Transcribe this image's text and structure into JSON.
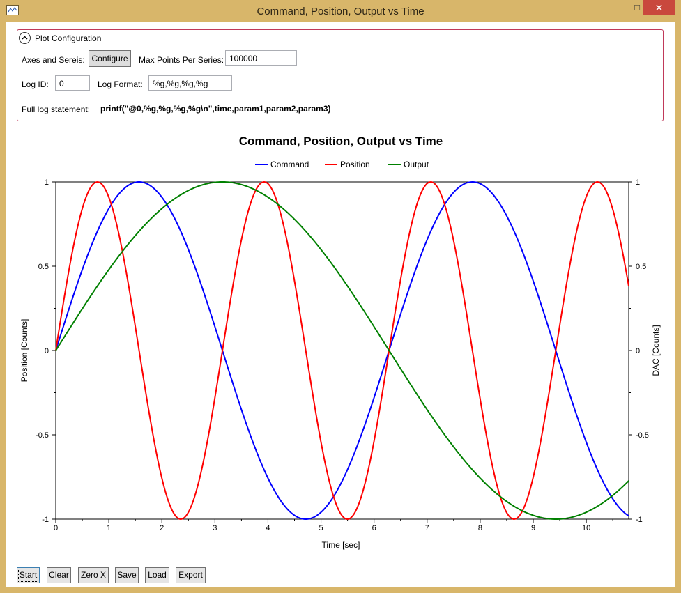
{
  "window": {
    "title": "Command, Position, Output vs Time",
    "minimize": "‒",
    "maximize": "□",
    "close": "✕"
  },
  "config": {
    "header": "Plot Configuration",
    "axes_label": "Axes and Sereis:",
    "configure_button": "Configure",
    "max_points_label": "Max Points Per Series:",
    "max_points_value": "100000",
    "log_id_label": "Log ID:",
    "log_id_value": "0",
    "log_format_label": "Log Format:",
    "log_format_value": "%g,%g,%g,%g",
    "full_log_label": "Full log statement:",
    "full_log_value": "printf(\"@0,%g,%g,%g,%g\\n\",time,param1,param2,param3)"
  },
  "buttons": {
    "start": "Start",
    "clear": "Clear",
    "zero_x": "Zero X",
    "save": "Save",
    "load": "Load",
    "export": "Export"
  },
  "chart_data": {
    "type": "line",
    "title": "Command, Position, Output vs Time",
    "xlabel": "Time [sec]",
    "ylabel": "Position [Counts]",
    "y2label": "DAC [Counts]",
    "xlim": [
      0,
      10.8
    ],
    "ylim": [
      -1,
      1
    ],
    "y2lim": [
      -1,
      1
    ],
    "x_ticks": [
      "0",
      "1",
      "2",
      "3",
      "4",
      "5",
      "6",
      "7",
      "8",
      "9",
      "10"
    ],
    "y_ticks": [
      "1",
      "0.5",
      "0",
      "-0.5",
      "-1"
    ],
    "legend_position": "top-center",
    "grid": false,
    "series": [
      {
        "name": "Command",
        "color": "#0000ff",
        "function": "sin(t)",
        "x": [
          0,
          0.4,
          0.8,
          1.2,
          1.57,
          2.0,
          2.4,
          2.8,
          3.14,
          3.6,
          4.0,
          4.4,
          4.71,
          5.2,
          5.6,
          6.0,
          6.28,
          6.8,
          7.2,
          7.6,
          7.85,
          8.2,
          8.6,
          9.0,
          9.42,
          9.8,
          10.2,
          10.6,
          10.8
        ],
        "values": [
          0,
          0.39,
          0.72,
          0.93,
          1.0,
          0.91,
          0.68,
          0.33,
          0,
          -0.44,
          -0.76,
          -0.95,
          -1.0,
          -0.88,
          -0.63,
          -0.28,
          0,
          0.49,
          0.79,
          0.97,
          1.0,
          0.94,
          0.73,
          0.41,
          0,
          -0.37,
          -0.7,
          -0.92,
          -0.98
        ]
      },
      {
        "name": "Position",
        "color": "#ff0000",
        "function": "sin(2t)",
        "x": [
          0,
          0.2,
          0.4,
          0.6,
          0.79,
          1.0,
          1.2,
          1.4,
          1.57,
          1.8,
          2.0,
          2.2,
          2.36,
          2.6,
          2.8,
          3.0,
          3.14,
          3.4,
          3.6,
          3.8,
          3.93,
          4.2,
          4.4,
          4.6,
          4.71,
          5.0,
          5.2,
          5.4,
          5.5,
          5.8,
          6.0,
          6.28,
          6.6,
          6.8,
          7.07,
          7.4,
          7.6,
          7.85,
          8.2,
          8.4,
          8.64,
          9.0,
          9.42,
          9.8,
          10.21,
          10.5,
          10.8
        ],
        "values": [
          0,
          0.39,
          0.72,
          0.93,
          1.0,
          0.91,
          0.68,
          0.33,
          0,
          -0.44,
          -0.76,
          -0.95,
          -1.0,
          -0.88,
          -0.63,
          -0.28,
          0,
          0.49,
          0.79,
          0.97,
          1.0,
          0.85,
          0.59,
          0.22,
          0,
          -0.54,
          -0.83,
          -0.98,
          -1.0,
          -0.88,
          -0.54,
          0,
          0.59,
          0.85,
          1.0,
          0.75,
          0.45,
          0,
          -0.57,
          -0.9,
          -1.0,
          -0.75,
          0,
          0.8,
          1.0,
          0.84,
          0.38
        ]
      },
      {
        "name": "Output",
        "color": "#008000",
        "function": "sin(t/2)",
        "x": [
          0,
          0.5,
          1.0,
          1.5,
          2.0,
          2.5,
          3.14,
          3.5,
          4.0,
          4.5,
          5.0,
          5.5,
          6.0,
          6.28,
          6.5,
          7.0,
          7.5,
          8.0,
          8.5,
          9.0,
          9.42,
          9.8,
          10.2,
          10.5,
          10.8
        ],
        "values": [
          0,
          0.25,
          0.48,
          0.68,
          0.84,
          0.95,
          1.0,
          0.98,
          0.91,
          0.78,
          0.6,
          0.38,
          0.14,
          0,
          -0.11,
          -0.35,
          -0.57,
          -0.76,
          -0.89,
          -0.98,
          -1.0,
          -0.98,
          -0.93,
          -0.86,
          -0.78
        ]
      }
    ]
  }
}
